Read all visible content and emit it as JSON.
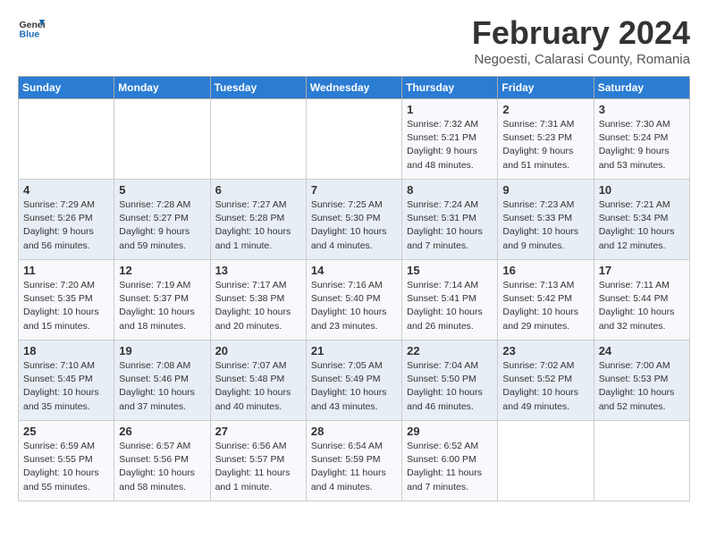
{
  "header": {
    "logo_general": "General",
    "logo_blue": "Blue",
    "title": "February 2024",
    "subtitle": "Negoesti, Calarasi County, Romania"
  },
  "columns": [
    "Sunday",
    "Monday",
    "Tuesday",
    "Wednesday",
    "Thursday",
    "Friday",
    "Saturday"
  ],
  "weeks": [
    [
      {
        "day": "",
        "info": ""
      },
      {
        "day": "",
        "info": ""
      },
      {
        "day": "",
        "info": ""
      },
      {
        "day": "",
        "info": ""
      },
      {
        "day": "1",
        "info": "Sunrise: 7:32 AM\nSunset: 5:21 PM\nDaylight: 9 hours\nand 48 minutes."
      },
      {
        "day": "2",
        "info": "Sunrise: 7:31 AM\nSunset: 5:23 PM\nDaylight: 9 hours\nand 51 minutes."
      },
      {
        "day": "3",
        "info": "Sunrise: 7:30 AM\nSunset: 5:24 PM\nDaylight: 9 hours\nand 53 minutes."
      }
    ],
    [
      {
        "day": "4",
        "info": "Sunrise: 7:29 AM\nSunset: 5:26 PM\nDaylight: 9 hours\nand 56 minutes."
      },
      {
        "day": "5",
        "info": "Sunrise: 7:28 AM\nSunset: 5:27 PM\nDaylight: 9 hours\nand 59 minutes."
      },
      {
        "day": "6",
        "info": "Sunrise: 7:27 AM\nSunset: 5:28 PM\nDaylight: 10 hours\nand 1 minute."
      },
      {
        "day": "7",
        "info": "Sunrise: 7:25 AM\nSunset: 5:30 PM\nDaylight: 10 hours\nand 4 minutes."
      },
      {
        "day": "8",
        "info": "Sunrise: 7:24 AM\nSunset: 5:31 PM\nDaylight: 10 hours\nand 7 minutes."
      },
      {
        "day": "9",
        "info": "Sunrise: 7:23 AM\nSunset: 5:33 PM\nDaylight: 10 hours\nand 9 minutes."
      },
      {
        "day": "10",
        "info": "Sunrise: 7:21 AM\nSunset: 5:34 PM\nDaylight: 10 hours\nand 12 minutes."
      }
    ],
    [
      {
        "day": "11",
        "info": "Sunrise: 7:20 AM\nSunset: 5:35 PM\nDaylight: 10 hours\nand 15 minutes."
      },
      {
        "day": "12",
        "info": "Sunrise: 7:19 AM\nSunset: 5:37 PM\nDaylight: 10 hours\nand 18 minutes."
      },
      {
        "day": "13",
        "info": "Sunrise: 7:17 AM\nSunset: 5:38 PM\nDaylight: 10 hours\nand 20 minutes."
      },
      {
        "day": "14",
        "info": "Sunrise: 7:16 AM\nSunset: 5:40 PM\nDaylight: 10 hours\nand 23 minutes."
      },
      {
        "day": "15",
        "info": "Sunrise: 7:14 AM\nSunset: 5:41 PM\nDaylight: 10 hours\nand 26 minutes."
      },
      {
        "day": "16",
        "info": "Sunrise: 7:13 AM\nSunset: 5:42 PM\nDaylight: 10 hours\nand 29 minutes."
      },
      {
        "day": "17",
        "info": "Sunrise: 7:11 AM\nSunset: 5:44 PM\nDaylight: 10 hours\nand 32 minutes."
      }
    ],
    [
      {
        "day": "18",
        "info": "Sunrise: 7:10 AM\nSunset: 5:45 PM\nDaylight: 10 hours\nand 35 minutes."
      },
      {
        "day": "19",
        "info": "Sunrise: 7:08 AM\nSunset: 5:46 PM\nDaylight: 10 hours\nand 37 minutes."
      },
      {
        "day": "20",
        "info": "Sunrise: 7:07 AM\nSunset: 5:48 PM\nDaylight: 10 hours\nand 40 minutes."
      },
      {
        "day": "21",
        "info": "Sunrise: 7:05 AM\nSunset: 5:49 PM\nDaylight: 10 hours\nand 43 minutes."
      },
      {
        "day": "22",
        "info": "Sunrise: 7:04 AM\nSunset: 5:50 PM\nDaylight: 10 hours\nand 46 minutes."
      },
      {
        "day": "23",
        "info": "Sunrise: 7:02 AM\nSunset: 5:52 PM\nDaylight: 10 hours\nand 49 minutes."
      },
      {
        "day": "24",
        "info": "Sunrise: 7:00 AM\nSunset: 5:53 PM\nDaylight: 10 hours\nand 52 minutes."
      }
    ],
    [
      {
        "day": "25",
        "info": "Sunrise: 6:59 AM\nSunset: 5:55 PM\nDaylight: 10 hours\nand 55 minutes."
      },
      {
        "day": "26",
        "info": "Sunrise: 6:57 AM\nSunset: 5:56 PM\nDaylight: 10 hours\nand 58 minutes."
      },
      {
        "day": "27",
        "info": "Sunrise: 6:56 AM\nSunset: 5:57 PM\nDaylight: 11 hours\nand 1 minute."
      },
      {
        "day": "28",
        "info": "Sunrise: 6:54 AM\nSunset: 5:59 PM\nDaylight: 11 hours\nand 4 minutes."
      },
      {
        "day": "29",
        "info": "Sunrise: 6:52 AM\nSunset: 6:00 PM\nDaylight: 11 hours\nand 7 minutes."
      },
      {
        "day": "",
        "info": ""
      },
      {
        "day": "",
        "info": ""
      }
    ]
  ]
}
